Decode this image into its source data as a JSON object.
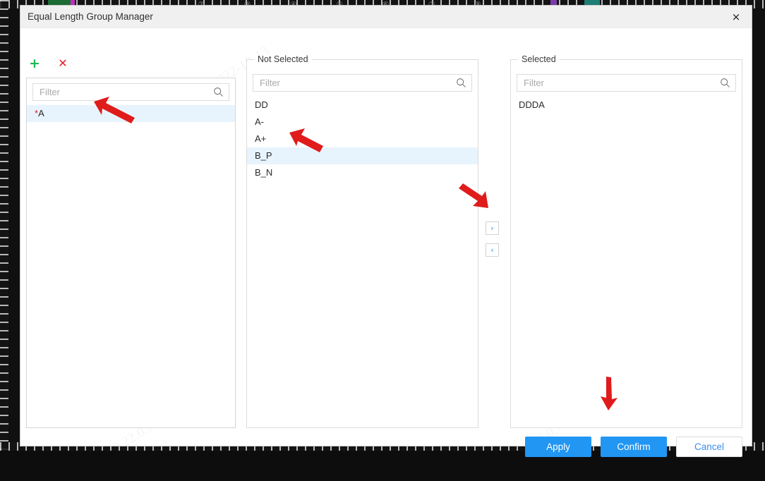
{
  "window": {
    "title": "Equal Length Group Manager",
    "close_label": "×"
  },
  "toolbar": {
    "add_label": "+",
    "add_icon": "plus-icon",
    "delete_label": "✕",
    "delete_icon": "cross-icon",
    "add_color": "#1db954",
    "delete_color": "#e8192c"
  },
  "left_panel": {
    "filter_placeholder": "Filter",
    "filter_value": "",
    "items": [
      {
        "prefix": "*",
        "label": "A",
        "selected": true
      }
    ]
  },
  "not_selected": {
    "legend": "Not Selected",
    "filter_placeholder": "Filter",
    "filter_value": "",
    "items": [
      {
        "label": "DD",
        "selected": false
      },
      {
        "label": "A-",
        "selected": false
      },
      {
        "label": "A+",
        "selected": false
      },
      {
        "label": "B_P",
        "selected": true
      },
      {
        "label": "B_N",
        "selected": false
      }
    ]
  },
  "selected": {
    "legend": "Selected",
    "filter_placeholder": "Filter",
    "filter_value": "",
    "items": [
      {
        "label": "DDDA",
        "selected": false
      }
    ]
  },
  "transfer": {
    "move_right_label": "›",
    "move_left_label": "‹",
    "icon_color": "#2196f3"
  },
  "footer": {
    "apply_label": "Apply",
    "confirm_label": "Confirm",
    "cancel_label": "Cancel",
    "primary_color": "#2196f3",
    "secondary_text_color": "#3d8ef0"
  },
  "annotations": {
    "arrow_color": "#e01b1b",
    "arrow_left_list": "points-to-left-list-item",
    "arrow_not_selected": "points-to-bp-item",
    "arrow_transfer": "points-to-move-right-button",
    "arrow_confirm": "points-to-confirm-button"
  },
  "background": {
    "top_icon_row": "② ③ ④ ⑤ ⑥ ⑦ ⑧"
  }
}
